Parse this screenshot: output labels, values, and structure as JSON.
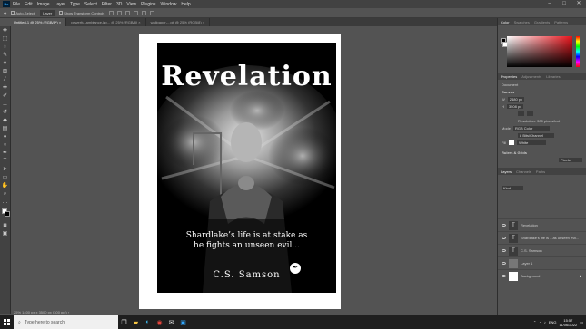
{
  "app": {
    "logo_text": "Ps"
  },
  "menubar": {
    "items": [
      "File",
      "Edit",
      "Image",
      "Layer",
      "Type",
      "Select",
      "Filter",
      "3D",
      "View",
      "Plugins",
      "Window",
      "Help"
    ]
  },
  "window_controls": {
    "minimize": "–",
    "maximize": "□",
    "close": "✕"
  },
  "options_bar": {
    "auto_select": "Auto-Select:",
    "auto_select_target": "Layer",
    "show_transform": "Show Transform Controls"
  },
  "tabs": [
    {
      "label": "Untitled-1 @ 25% (RGB/8*) ×",
      "active": true
    },
    {
      "label": "powerful-ambiance-hp... @ 25% (RGB/8) ×",
      "active": false
    },
    {
      "label": "wallpaper-...gif @ 25% (RGB/8) ×",
      "active": false
    }
  ],
  "cover": {
    "title": "Revelation",
    "tagline_line1": "Shardlake’s life is at stake as",
    "tagline_line2": "he fights an unseen evil...",
    "author": "C.S. Samson",
    "quill": "✒"
  },
  "status_bar": {
    "text": "25%    1400 px x 3500 px (300 ppi)  ›"
  },
  "right_panel": {
    "color_tabs": [
      "Color",
      "Swatches",
      "Gradients",
      "Patterns"
    ],
    "properties_tabs": [
      "Properties",
      "Adjustments",
      "Libraries"
    ],
    "document_label": "Document",
    "canvas_section": "Canvas",
    "width_label": "W",
    "width_value": "2480 px",
    "height_label": "H",
    "height_value": "3508 px",
    "resolution": "Resolution: 300 pixels/inch",
    "mode_label": "Mode",
    "mode_value": "RGB Color",
    "bit_value": "8 Bits/Channel",
    "fill_label": "Fill",
    "fill_value": "White",
    "rulers_section": "Rulers & Grids",
    "rulers_unit": "Pixels",
    "layers_tabs": [
      "Layers",
      "Channels",
      "Paths"
    ],
    "layer_filter": "Kind",
    "layers": [
      {
        "name": "Revelation",
        "thumb": "T"
      },
      {
        "name": "Shardlake's life is ...as unseen evil...",
        "thumb": "T"
      },
      {
        "name": "C.S. Samson",
        "thumb": "T"
      },
      {
        "name": "Layer 1",
        "thumb": ""
      },
      {
        "name": "Background",
        "thumb": ""
      }
    ]
  },
  "taskbar": {
    "search_placeholder": "Type here to search",
    "time": "15:57",
    "date": "11/06/2022",
    "tray_label": "ENG"
  },
  "colors": {
    "menubar": "#424242",
    "workspace": "#535353",
    "taskbar": "#1f1f1f",
    "accent": "#31a8ff"
  }
}
